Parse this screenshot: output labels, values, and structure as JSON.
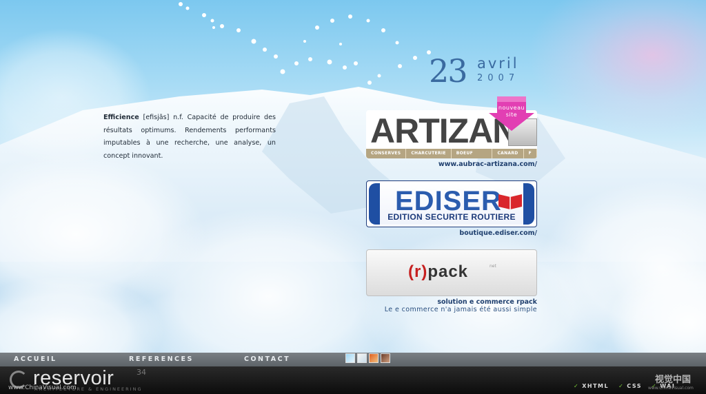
{
  "date": {
    "day": "23",
    "month": "avril",
    "year": "2007"
  },
  "definition": {
    "term": "Efficience",
    "text": " [efisjãs] n.f. Capacité de produire des résultats optimums. Rendements performants imputables à une recherche, une analyse, un concept innovant."
  },
  "banners": {
    "artizana": {
      "logo": "ARTIZANA",
      "badge": "nouveau site",
      "categories": [
        "CONSERVES",
        "CHARCUTERIE",
        "BOEUF FERMIER",
        "CANARD",
        "F"
      ],
      "url": "www.aubrac-artizana.com/"
    },
    "ediser": {
      "logo": "EDISER",
      "subtitle": "EDITION SECURITE ROUTIERE",
      "url": "boutique.ediser.com/"
    },
    "rpack": {
      "logo_prefix": "(r)",
      "logo_suffix": "pack",
      "logo_net": "net",
      "title": "solution e commerce rpack",
      "tagline": "Le e commerce n'a jamais été aussi simple"
    }
  },
  "nav": {
    "home": "ACCUEIL",
    "references": "REFERENCES",
    "contact": "CONTACT"
  },
  "footer": {
    "brand": "reservoir",
    "brand_number": "34",
    "brand_sub": "ARCHITECTURE & ENGINEERING",
    "watermark_left": "www.ChinaVisual.com",
    "badges": [
      "XHTML",
      "CSS",
      "WAI"
    ],
    "watermark_right": "视觉中国",
    "watermark_right_url": "www.ChinaVisual.com"
  },
  "colors": {
    "accent": "#3a6aa0",
    "badge_pink": "#e040b0",
    "check": "#7cd03a"
  }
}
